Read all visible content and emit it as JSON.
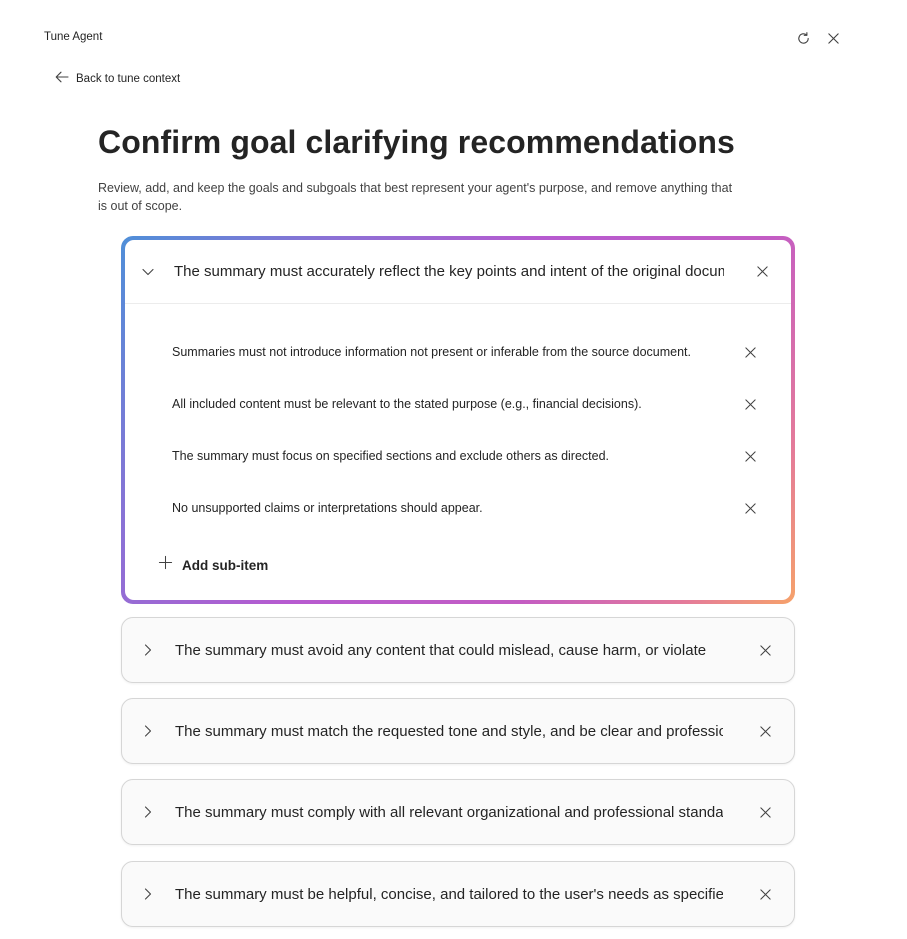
{
  "app": {
    "title": "Tune Agent"
  },
  "header": {
    "refresh_icon": "refresh-icon",
    "close_icon": "close-icon"
  },
  "nav": {
    "back_label": "Back to tune context"
  },
  "page": {
    "title": "Confirm goal clarifying recommendations",
    "description": "Review, add, and keep the goals and subgoals that best represent your agent's purpose, and remove anything that is out of scope."
  },
  "goals": [
    {
      "text": "The summary must accurately reflect the key points and intent of the original document",
      "expanded": true,
      "subitems": [
        "Summaries must not introduce information not present or inferable from the source document.",
        "All included content must be relevant to the stated purpose (e.g., financial decisions).",
        "The summary must focus on specified sections and exclude others as directed.",
        "No unsupported claims or interpretations should appear."
      ],
      "add_label": "Add sub-item"
    },
    {
      "text": "The summary must avoid any content that could mislead, cause harm, or violate",
      "expanded": false
    },
    {
      "text": "The summary must match the requested tone and style, and be clear and professional",
      "expanded": false
    },
    {
      "text": "The summary must comply with all relevant organizational and professional standards",
      "expanded": false
    },
    {
      "text": "The summary must be helpful, concise, and tailored to the user's needs as specified",
      "expanded": false
    }
  ],
  "colors": {
    "gradient_start": "#4f8fd8",
    "gradient_mid": "#c35cc4",
    "gradient_end": "#f6a26a"
  }
}
